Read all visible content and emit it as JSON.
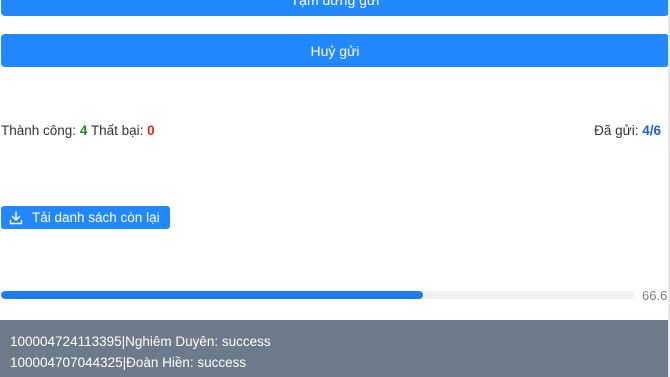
{
  "buttons": {
    "pause_label": "Tạm dừng gửi",
    "cancel_label": "Huỷ gửi",
    "download_label": "Tải danh sách còn lại"
  },
  "stats": {
    "success_label": "Thành công:",
    "success_count": "4",
    "fail_label": "Thất bại:",
    "fail_count": "0",
    "sent_label": "Đã gửi:",
    "sent_value": "4/6"
  },
  "progress": {
    "percent": 66.6,
    "text": "66.6"
  },
  "log": [
    "100004724113395|Nghiêm Duyên: success",
    "100004707044325|Đoàn Hiền: success"
  ],
  "colors": {
    "primary": "#2188ff",
    "success": "#1a8a1a",
    "danger": "#e0241b",
    "log_bg": "#6c7a89"
  },
  "icons": {
    "download": "download-icon"
  }
}
